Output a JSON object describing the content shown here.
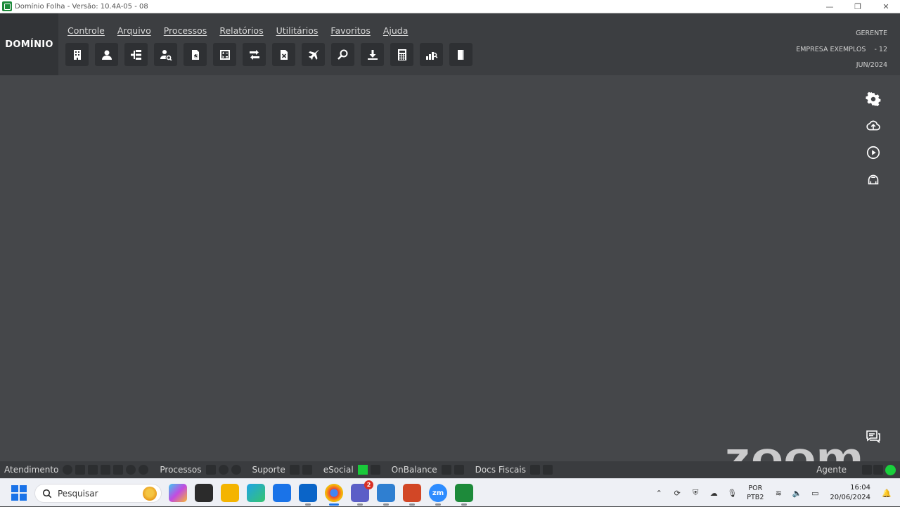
{
  "window": {
    "title": "Domínio Folha - Versão: 10.4A-05 - 08",
    "minimize": "—",
    "restore": "❐",
    "close": "✕"
  },
  "brand": "DOMÍNIO",
  "menu": [
    "Controle",
    "Arquivo",
    "Processos",
    "Relatórios",
    "Utilitários",
    "Favoritos",
    "Ajuda"
  ],
  "toolbar_icons": [
    "building-icon",
    "person-icon",
    "hierarchy-icon",
    "person-search-icon",
    "document-refresh-icon",
    "calculator-sheet-icon",
    "transfer-icon",
    "document-x-icon",
    "airplane-icon",
    "magnifier-icon",
    "download-icon",
    "calculator-icon",
    "chart-search-icon",
    "book-icon"
  ],
  "user": {
    "role": "GERENTE",
    "company": "EMPRESA EXEMPLOS",
    "company_code": "- 12",
    "period": "JUN/2024"
  },
  "side_icons": [
    "gear-icon",
    "cloud-upload-icon",
    "play-icon",
    "support-icon"
  ],
  "watermark": "zoom",
  "statusbar": {
    "groups": [
      "Atendimento",
      "Processos",
      "Suporte",
      "eSocial",
      "OnBalance",
      "Docs Fiscais"
    ],
    "agent": "Agente"
  },
  "taskbar": {
    "search_placeholder": "Pesquisar",
    "teams_badge": "2",
    "zoom_label": "zm",
    "lang_line1": "POR",
    "lang_line2": "PTB2",
    "time": "16:04",
    "date": "20/06/2024"
  },
  "colors": {
    "header": "#3c3e41",
    "main": "#45474a",
    "status_green": "#19d03c"
  }
}
